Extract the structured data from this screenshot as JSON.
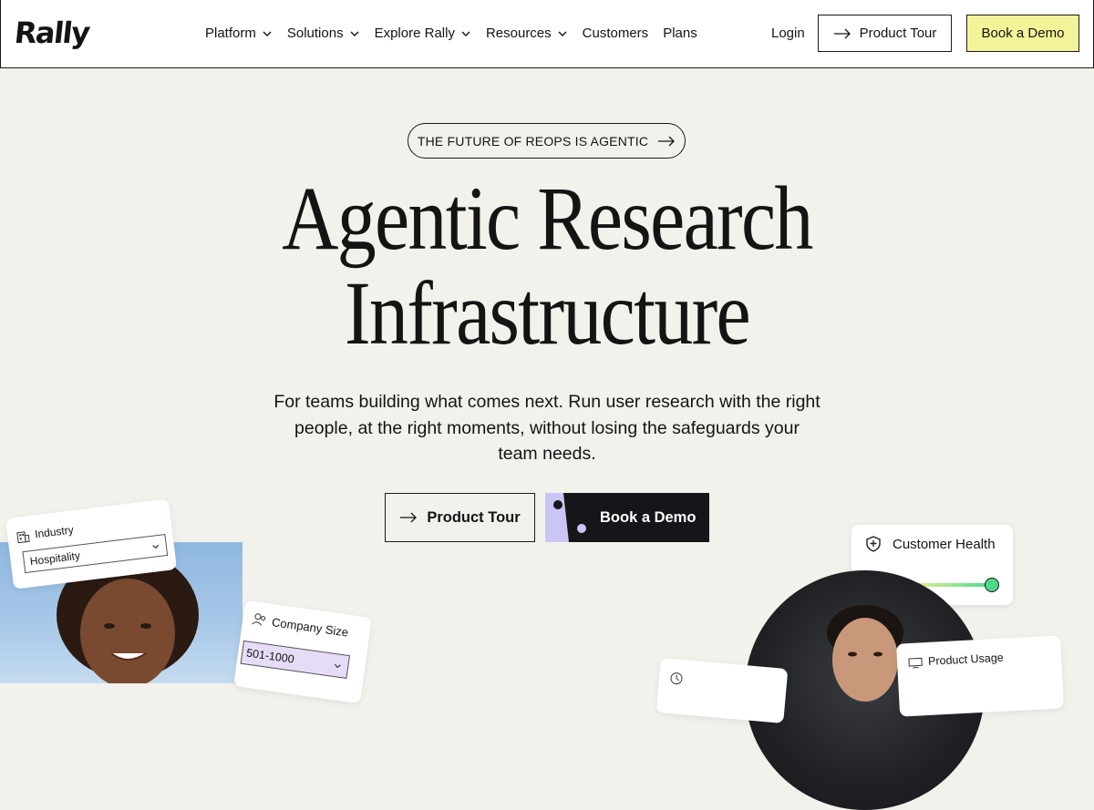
{
  "header": {
    "logo": "Rally",
    "nav": [
      {
        "label": "Platform",
        "dropdown": true
      },
      {
        "label": "Solutions",
        "dropdown": true
      },
      {
        "label": "Explore Rally",
        "dropdown": true
      },
      {
        "label": "Resources",
        "dropdown": true
      },
      {
        "label": "Customers",
        "dropdown": false
      },
      {
        "label": "Plans",
        "dropdown": false
      }
    ],
    "login": "Login",
    "product_tour": "Product Tour",
    "book_demo": "Book a Demo"
  },
  "hero": {
    "pill": "THE FUTURE OF REOPS IS AGENTIC",
    "title_line1": "Agentic Research",
    "title_line2": "Infrastructure",
    "subtitle": "For teams building what comes next. Run user research with the right people, at the right moments,  without losing the safeguards your team needs.",
    "cta_tour": "Product Tour",
    "cta_demo": "Book a Demo"
  },
  "cards": {
    "industry_label": "Industry",
    "industry_value": "Hospitality",
    "company_size_label": "Company Size",
    "company_size_value": "501-1000",
    "customer_health_label": "Customer Health",
    "product_usage_label": "Product Usage"
  },
  "colors": {
    "background": "#f3f1ec",
    "demo_button": "#f3f39a",
    "dark_button": "#16161a",
    "accent_lavender": "#c9c5f5",
    "health_dot": "#4cd98a"
  }
}
